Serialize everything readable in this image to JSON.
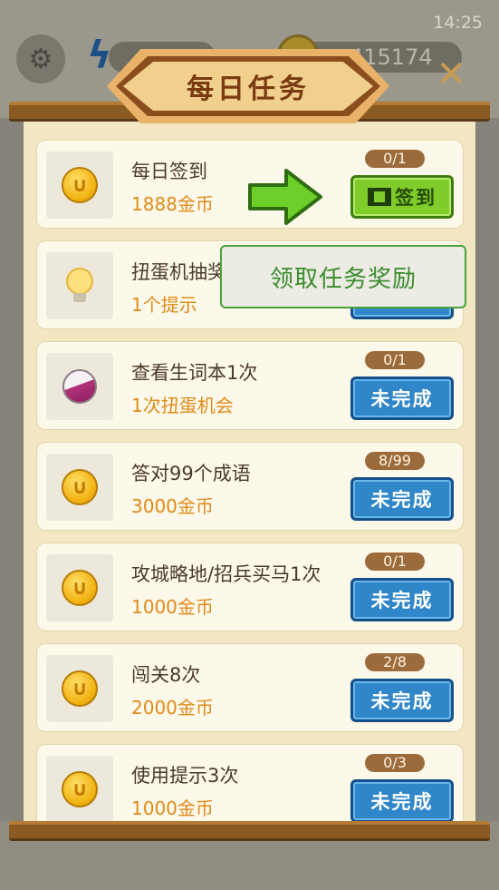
{
  "status_bar": {
    "time": "14:25"
  },
  "top_bar": {
    "energy_value": "",
    "coin_value": "415174"
  },
  "dialog": {
    "title": "每日任务",
    "close_symbol": "✕"
  },
  "tooltip": {
    "text": "领取任务奖励"
  },
  "tasks": [
    {
      "title": "每日签到",
      "reward": "1888金币",
      "progress": "0/1",
      "button": "签到",
      "button_state": "claim",
      "icon": "coin-icon"
    },
    {
      "title": "扭蛋机抽奖",
      "reward": "1个提示",
      "progress": "",
      "button": "",
      "button_state": "hidden",
      "icon": "lightbulb-icon"
    },
    {
      "title": "查看生词本1次",
      "reward": "1次扭蛋机会",
      "progress": "0/1",
      "button": "未完成",
      "button_state": "incomplete",
      "icon": "capsule-ball-icon"
    },
    {
      "title": "答对99个成语",
      "reward": "3000金币",
      "progress": "8/99",
      "button": "未完成",
      "button_state": "incomplete",
      "icon": "coin-icon"
    },
    {
      "title": "攻城略地/招兵买马1次",
      "reward": "1000金币",
      "progress": "0/1",
      "button": "未完成",
      "button_state": "incomplete",
      "icon": "coin-icon"
    },
    {
      "title": "闯关8次",
      "reward": "2000金币",
      "progress": "2/8",
      "button": "未完成",
      "button_state": "incomplete",
      "icon": "coin-icon"
    },
    {
      "title": "使用提示3次",
      "reward": "1000金币",
      "progress": "0/3",
      "button": "未完成",
      "button_state": "incomplete",
      "icon": "coin-icon"
    }
  ],
  "colors": {
    "reward_orange": "#e08a1a",
    "button_blue": "#2f86c9",
    "button_green": "#7fcc2a",
    "panel_bg": "#f3e6c2"
  }
}
